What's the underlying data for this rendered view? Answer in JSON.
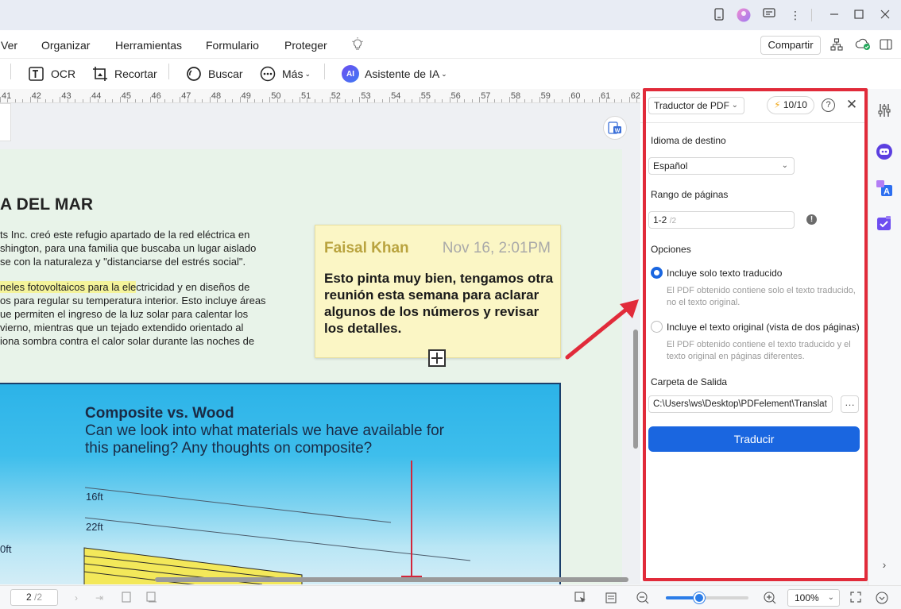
{
  "menu": {
    "items": [
      "Ver",
      "Organizar",
      "Herramientas",
      "Formulario",
      "Proteger"
    ],
    "share_label": "Compartir"
  },
  "toolbar": {
    "ocr": "OCR",
    "crop": "Recortar",
    "search": "Buscar",
    "more": "Más",
    "ai": "Asistente de IA",
    "ai_badge": "AI"
  },
  "ruler": {
    "numbers": [
      "41",
      "42",
      "43",
      "44",
      "45",
      "46",
      "47",
      "48",
      "49",
      "50",
      "51",
      "52",
      "53",
      "54",
      "55",
      "56",
      "57",
      "58",
      "59",
      "60",
      "61",
      "62"
    ]
  },
  "document": {
    "title": "A DEL MAR",
    "para1": [
      "ts Inc. creó este refugio apartado de la red eléctrica en",
      "shington, para una familia que buscaba un lugar aislado",
      "se con la naturaleza y \"distanciarse del estrés social\"."
    ],
    "para2_highlight": "neles fotovoltaicos para la ele",
    "para2_first_rest": "ctricidad y en diseños de",
    "para2": [
      "os para regular su temperatura interior. Esto incluye áreas",
      "ue permiten el ingreso de la luz solar para calentar los",
      "vierno, mientras que un tejado extendido orientado al",
      "iona sombra contra el calor solar durante las noches de"
    ],
    "note": {
      "author": "Faisal Khan",
      "date": "Nov 16, 2:01PM",
      "body": "Esto pinta muy bien, tengamos otra reunión esta semana para aclarar algunos de los números y revisar los detalles."
    },
    "image": {
      "title": "Composite vs. Wood",
      "subtitle": "Can we look into what materials we have available for this paneling? Any thoughts on composite?",
      "labels": [
        "16ft",
        "22ft",
        "0ft"
      ]
    }
  },
  "panel": {
    "mode": "Traductor de PDF",
    "credits": "10/10",
    "help": "?",
    "close": "✕",
    "target_lang_label": "Idioma de destino",
    "target_lang_value": "Español",
    "page_range_label": "Rango de páginas",
    "page_range_value": "1-2",
    "page_range_total": "/2",
    "options_label": "Opciones",
    "option1": {
      "label": "Incluye solo texto traducido",
      "desc": "El PDF obtenido contiene solo el texto traducido, no el texto original.",
      "selected": true
    },
    "option2": {
      "label": "Incluye el texto original (vista de dos páginas)",
      "desc": "El PDF obtenido contiene el texto traducido y el texto original en páginas diferentes.",
      "selected": false
    },
    "output_folder_label": "Carpeta de Salida",
    "output_folder_value": "C:\\Users\\ws\\Desktop\\PDFelement\\Translat",
    "translate_label": "Traducir",
    "outline_color": "#e12b3a",
    "accent": "#1a66e0"
  },
  "status": {
    "page_current": "2",
    "page_total": "/2",
    "zoom_label": "100%",
    "zoom_level": 0.4
  }
}
